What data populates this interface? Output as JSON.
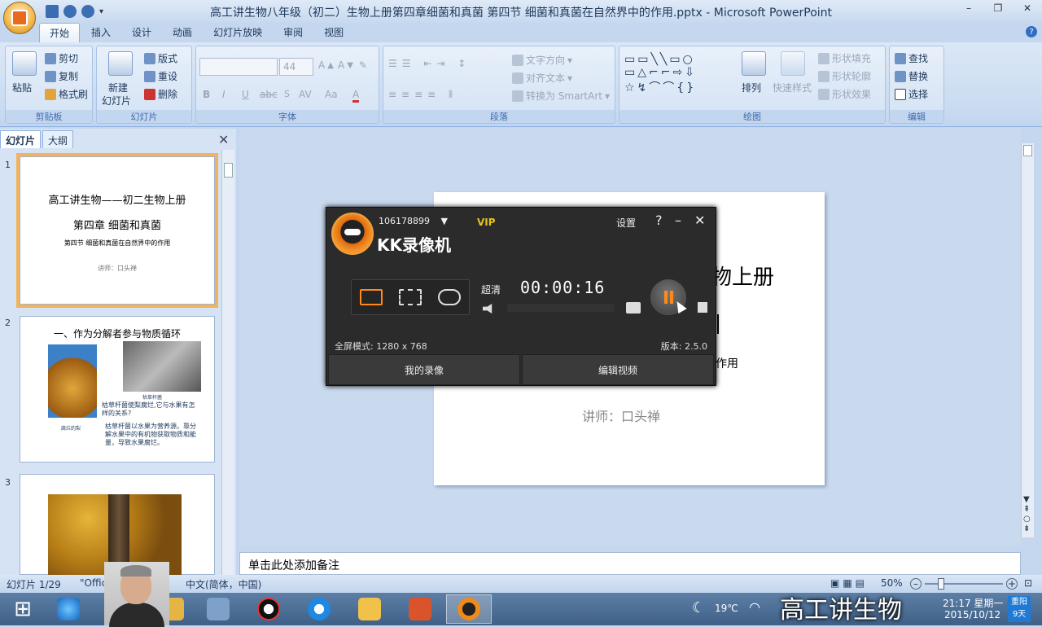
{
  "window": {
    "title": "高工讲生物八年级（初二）生物上册第四章细菌和真菌 第四节 细菌和真菌在自然界中的作用.pptx - Microsoft PowerPoint"
  },
  "ribbon_tabs": [
    {
      "label": "开始",
      "active": true
    },
    {
      "label": "插入"
    },
    {
      "label": "设计"
    },
    {
      "label": "动画"
    },
    {
      "label": "幻灯片放映"
    },
    {
      "label": "审阅"
    },
    {
      "label": "视图"
    }
  ],
  "clipboard": {
    "title": "剪贴板",
    "paste": "粘贴",
    "cut": "剪切",
    "copy": "复制",
    "format_painter": "格式刷"
  },
  "slides_group": {
    "title": "幻灯片",
    "new_slide": "新建",
    "new_slide2": "幻灯片",
    "layout": "版式",
    "reset": "重设",
    "delete": "删除"
  },
  "font_group": {
    "title": "字体",
    "size": "44",
    "bold": "B",
    "italic": "I",
    "underline": "U",
    "strike": "abc",
    "spacing": "AV",
    "case": "Aa",
    "color": "A"
  },
  "paragraph_group": {
    "title": "段落",
    "text_direction": "文字方向",
    "align_text": "对齐文本",
    "smartart": "转换为 SmartArt"
  },
  "drawing_group": {
    "title": "绘图",
    "arrange": "排列",
    "quick_styles": "快速样式",
    "fill": "形状填充",
    "outline": "形状轮廓",
    "effects": "形状效果"
  },
  "editing_group": {
    "title": "编辑",
    "find": "查找",
    "replace": "替换",
    "select": "选择"
  },
  "panel_tabs": {
    "slides": "幻灯片",
    "outline": "大纲"
  },
  "thumbs": {
    "t1_num": "1",
    "t1_l1": "高工讲生物——初二生物上册",
    "t1_l2": "第四章 细菌和真菌",
    "t1_l3": "第四节 细菌和真菌在自然界中的作用",
    "t1_l4": "讲师：口头禅",
    "t2_num": "2",
    "t2_title": "一、作为分解者参与物质循环",
    "t2_cap1": "枯草杆菌",
    "t2_cap2": "腐烂的梨",
    "t2_q": "枯草杆菌使梨腐烂,它与水果有怎样的关系?",
    "t2_a": "枯草杆菌以水果为营养源。靠分解水果中的有机物获取物质和能量，导致水果腐烂。",
    "t3_num": "3"
  },
  "slide": {
    "line1_partial": "物上册",
    "line3_partial": "作用",
    "lecturer": "讲师：口头禅"
  },
  "notes": {
    "placeholder": "单击此处添加备注"
  },
  "status": {
    "slide_count": "幻灯片 1/29",
    "theme": "\"Offic",
    "language": "中文(简体，中国)",
    "zoom": "50%"
  },
  "kk": {
    "user": "106178899",
    "vip": "VIP",
    "app_name": "KK录像机",
    "settings": "设置",
    "help": "?",
    "minimize": "–",
    "close": "✕",
    "quality": "超清",
    "time": "00:00:16",
    "mode": "全屏模式: 1280 x 768",
    "version": "版本: 2.5.0",
    "my_recordings": "我的录像",
    "edit_video": "编辑视频"
  },
  "taskbar": {
    "temp": "19℃",
    "time": "21:17 星期一",
    "date": "2015/10/12",
    "weather": "重阳",
    "weather2": "9天"
  },
  "overlay": {
    "brand": "高工讲生物"
  }
}
